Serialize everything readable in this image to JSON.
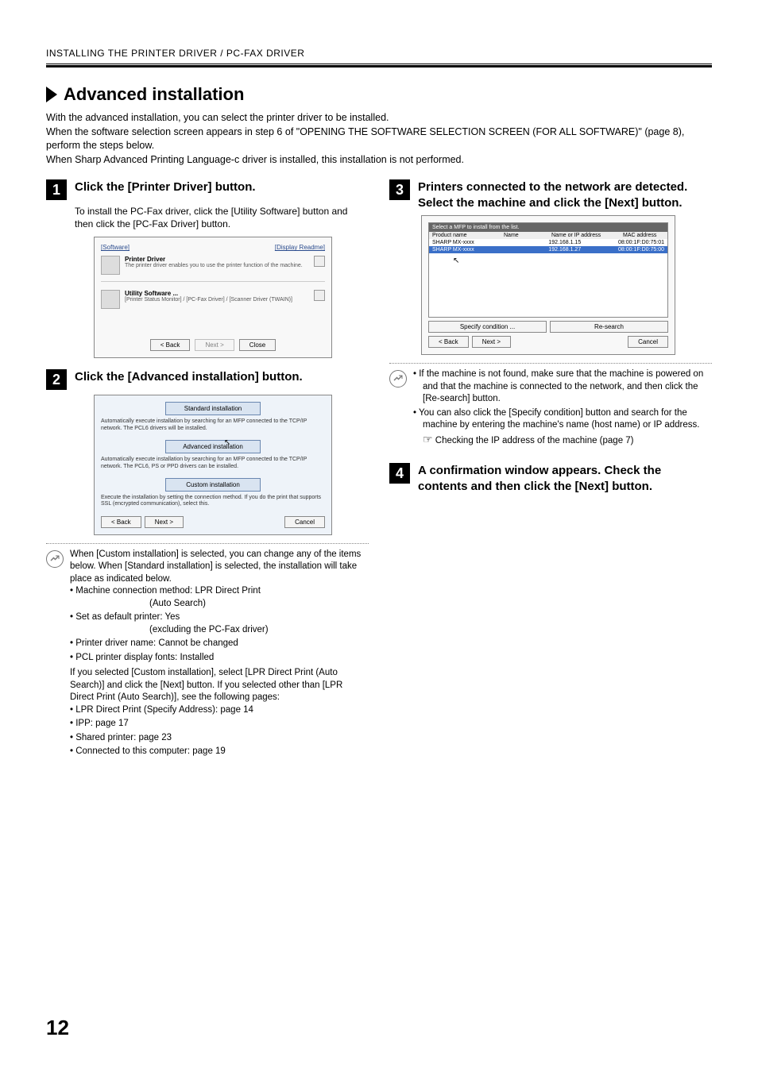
{
  "header": "INSTALLING THE PRINTER DRIVER / PC-FAX DRIVER",
  "section_title": "Advanced installation",
  "intro_lines": [
    "With the advanced installation, you can select the printer driver to be installed.",
    "When the software selection screen appears in step 6 of \"OPENING THE SOFTWARE SELECTION SCREEN (FOR ALL SOFTWARE)\" (page 8), perform the steps below.",
    "When Sharp Advanced Printing Language-c driver is installed, this installation is not performed."
  ],
  "step1": {
    "num": "1",
    "title": "Click the [Printer Driver] button.",
    "sub": "To install the PC-Fax driver, click the [Utility Software] button and then click the [PC-Fax Driver] button.",
    "sc": {
      "software_link": "[Software]",
      "readme_link": "[Display Readme]",
      "pd_title": "Printer Driver",
      "pd_desc": "The printer driver enables you to use the printer function of the machine.",
      "us_title": "Utility Software ...",
      "us_desc": "[Printer Status Monitor] / [PC-Fax Driver] / [Scanner Driver (TWAIN)]",
      "back": "< Back",
      "next": "Next >",
      "close": "Close"
    }
  },
  "step2": {
    "num": "2",
    "title": "Click the [Advanced installation] button.",
    "sc": {
      "std_btn": "Standard installation",
      "std_desc": "Automatically execute installation by searching for an MFP connected to the TCP/IP network. The PCL6 drivers will be installed.",
      "adv_btn": "Advanced installation",
      "adv_desc": "Automatically execute installation by searching for an MFP connected to the TCP/IP network. The PCL6, PS or PPD drivers can be installed.",
      "cus_btn": "Custom installation",
      "cus_desc": "Execute the installation by setting the connection method. If you do the print that supports SSL (encrypted communication), select this.",
      "back": "< Back",
      "next": "Next >",
      "cancel": "Cancel"
    }
  },
  "note2": {
    "p1": "When [Custom installation] is selected, you can change any of the items below. When [Standard installation] is selected, the installation will take place as indicated below.",
    "b1": "Machine connection method: LPR Direct Print",
    "b1b": "(Auto Search)",
    "b2": "Set as default printer: Yes",
    "b2b": "(excluding the PC-Fax driver)",
    "b3": "Printer driver name: Cannot be changed",
    "b4": "PCL printer display fonts: Installed",
    "p2": "If you selected [Custom installation], select [LPR Direct Print (Auto Search)] and click the [Next] button. If you selected other than [LPR Direct Print (Auto Search)], see the following pages:",
    "c1": "LPR Direct Print (Specify Address): page 14",
    "c2": "IPP: page 17",
    "c3": "Shared printer: page 23",
    "c4": "Connected to this computer: page 19"
  },
  "step3": {
    "num": "3",
    "title": "Printers connected to the network are detected. Select the machine and click the [Next] button.",
    "sc": {
      "head": "Select a MFP to install from the list.",
      "col1": "Product name",
      "col2": "Name",
      "col3": "Name or IP address",
      "col4": "MAC address",
      "r1a": "SHARP MX-xxxx",
      "r1c": "192.168.1.15",
      "r1d": "08:00:1F:D0:75:01",
      "r2a": "SHARP MX-xxxx",
      "r2c": "192.168.1.27",
      "r2d": "08:00:1F:D0:75:00",
      "spec": "Specify condition ...",
      "research": "Re-search",
      "back": "< Back",
      "next": "Next >",
      "cancel": "Cancel"
    }
  },
  "note3": {
    "b1": "If the machine is not found, make sure that the machine is powered on and that the machine is connected to the network, and then click the [Re-search] button.",
    "b2": "You can also click the [Specify condition] button and search for the machine by entering the machine's name (host name) or IP address.",
    "b2link": "Checking the IP address of the machine (page 7)"
  },
  "step4": {
    "num": "4",
    "title": "A confirmation window appears. Check the contents and then click the [Next] button."
  },
  "page_number": "12"
}
